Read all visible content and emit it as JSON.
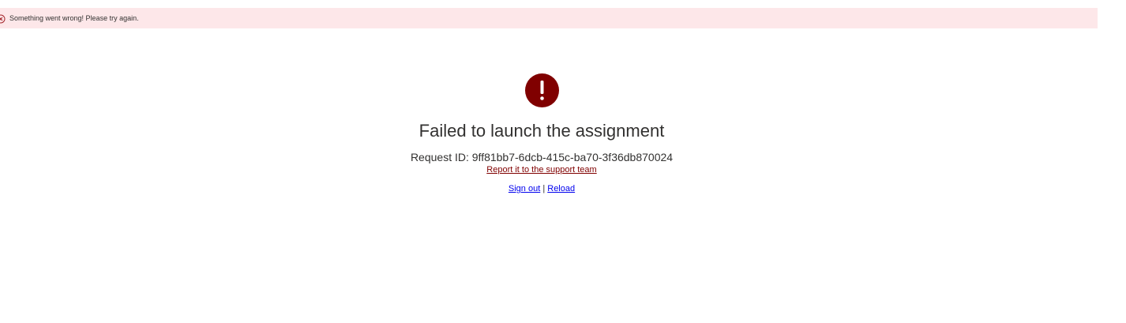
{
  "banner": {
    "message": "Something went wrong! Please try again.",
    "icon": "error-circle-icon",
    "background": "#fde7e9"
  },
  "error": {
    "icon": "exclamation-icon",
    "icon_glyph": "!",
    "icon_color": "#800000",
    "title": "Failed to launch the assignment",
    "request_id_label": "Request ID:",
    "request_id": "9ff81bb7-6dcb-415c-ba70-3f36db870024",
    "report_link": "Report it to the support team"
  },
  "actions": {
    "sign_out": "Sign out",
    "separator": "|",
    "reload": "Reload"
  }
}
